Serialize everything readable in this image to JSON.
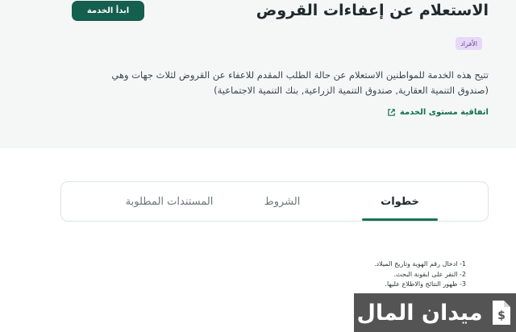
{
  "header": {
    "title": "الاستعلام عن إعفاءات القروض",
    "start_button": "ابدأ الخدمة",
    "badge": "الأفراد"
  },
  "description": {
    "line1": "تتيح هذه الخدمة للمواطنين الاستعلام عن حالة الطلب المقدم للاعفاء عن القروض لثلاث جهات وهي",
    "line2": "(صندوق التنمية العقارية, صندوق التنمية الزراعية, بنك التنمية الاجتماعية)"
  },
  "sla_link": {
    "label": "اتفاقية مستوى الخدمة",
    "icon": "external-link-icon"
  },
  "tabs": [
    {
      "label": "خطوات",
      "active": true
    },
    {
      "label": "الشروط",
      "active": false
    },
    {
      "label": "المستندات المطلوبة",
      "active": false
    }
  ],
  "steps": [
    "1- ادخال رقم الهوية وتاريخ الميلاد.",
    "2- النقر على ايقونة البحث.",
    "3- ظهور النتائج والاطلاع عليها."
  ],
  "watermark": {
    "text": "ميدان المال",
    "icon": "money-logo-icon"
  },
  "colors": {
    "primary": "#145f4e",
    "accent": "#1a7353",
    "badge_bg": "#e7d9f6",
    "badge_text": "#6a3fa0",
    "hero_bg": "#f5f7f7"
  }
}
